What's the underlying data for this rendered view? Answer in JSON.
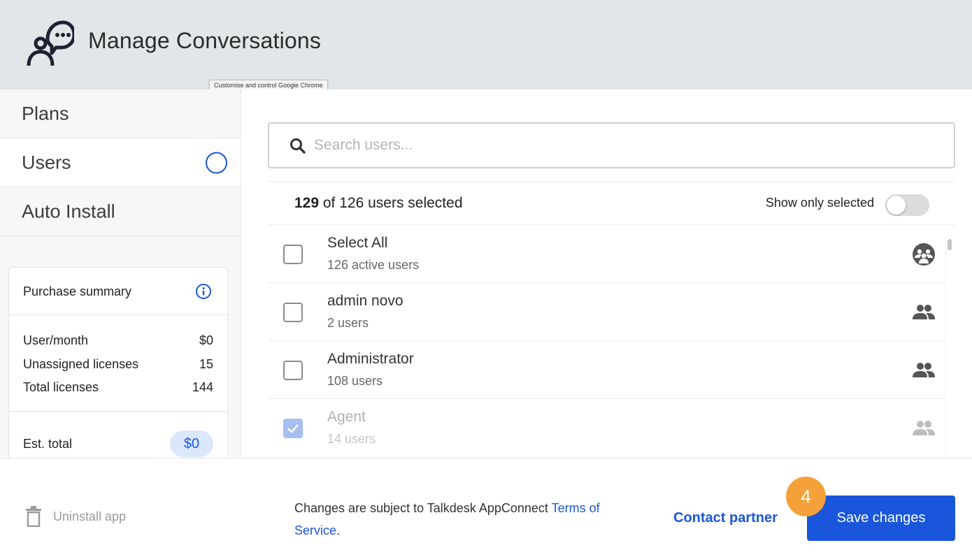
{
  "header": {
    "app_title": "Manage Conversations",
    "tooltip": "Customise and control Google Chrome",
    "logo_icon": "conversation-person-icon"
  },
  "sidebar": {
    "items": [
      {
        "label": "Plans",
        "active": false
      },
      {
        "label": "Users",
        "active": true
      },
      {
        "label": "Auto Install",
        "active": false
      }
    ]
  },
  "summary": {
    "title": "Purchase summary",
    "rows": [
      {
        "label": "User/month",
        "value": "$0"
      },
      {
        "label": "Unassigned licenses",
        "value": "15"
      },
      {
        "label": "Total licenses",
        "value": "144"
      }
    ],
    "total_label": "Est. total",
    "total_value": "$0"
  },
  "search": {
    "placeholder": "Search users..."
  },
  "selection": {
    "selected_count": "129",
    "count_text": " of 126 users selected",
    "show_only_selected_label": "Show only selected",
    "show_only_selected": false
  },
  "list": {
    "rows": [
      {
        "title": "Select All",
        "subtitle": "126 active users",
        "checked": false,
        "icon": "group-circle-icon"
      },
      {
        "title": "admin novo",
        "subtitle": "2 users",
        "checked": false,
        "icon": "people-icon"
      },
      {
        "title": "Administrator",
        "subtitle": "108 users",
        "checked": false,
        "icon": "people-icon"
      },
      {
        "title": "Agent",
        "subtitle": "14 users",
        "checked": true,
        "icon": "people-icon"
      }
    ]
  },
  "footer": {
    "uninstall_label": "Uninstall app",
    "terms_prefix": "Changes are subject to Talkdesk AppConnect ",
    "terms_link_1": "Terms of",
    "terms_link_2": "Service",
    "terms_suffix": ".",
    "contact_label": "Contact partner",
    "save_label": "Save changes",
    "step_badge": "4"
  },
  "colors": {
    "accent": "#1a56db",
    "header_bg": "#e3e6e8",
    "badge": "#f5a13a"
  }
}
